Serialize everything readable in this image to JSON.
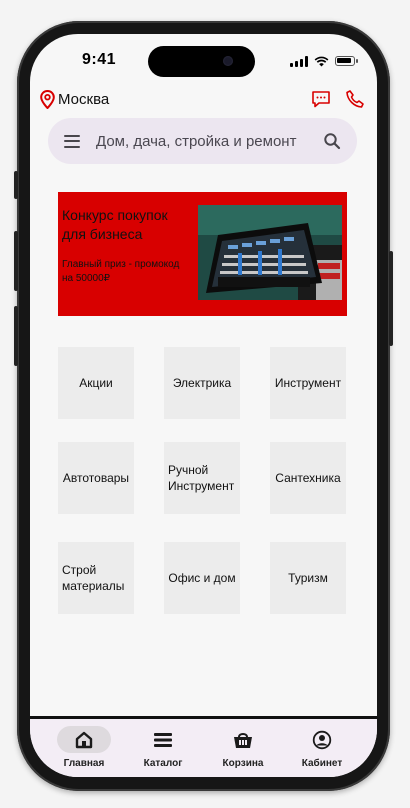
{
  "status_bar": {
    "time": "9:41"
  },
  "header": {
    "city": "Москва"
  },
  "search": {
    "placeholder": "Дом, дача, стройка и ремонт"
  },
  "banner": {
    "title": "Конкурс покупок для бизнеса",
    "subtitle": "Главный приз - промокод на 50000₽"
  },
  "categories": [
    "Акции",
    "Электрика",
    "Инструмент",
    "Автотовары",
    "Ручной Инструмент",
    "Сантехника",
    "Строй материалы",
    "Офис и дом",
    "Туризм"
  ],
  "nav": {
    "home": "Главная",
    "catalog": "Каталог",
    "cart": "Корзина",
    "account": "Кабинет"
  },
  "colors": {
    "accent": "#d80000",
    "search_bg": "#ece6f0",
    "nav_bg": "#f3edf5"
  },
  "icons": [
    "location-pin-icon",
    "chat-icon",
    "phone-icon",
    "menu-icon",
    "search-icon",
    "home-icon",
    "catalog-icon",
    "cart-icon",
    "account-icon"
  ]
}
